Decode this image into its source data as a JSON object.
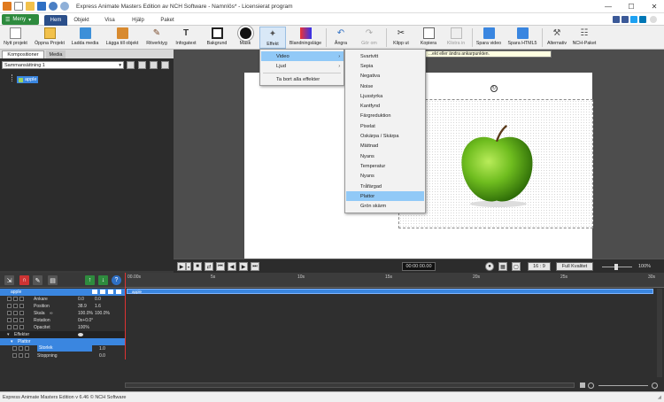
{
  "window": {
    "title": "Express Animate Masters Edition av NCH Software - Namnlös* - Licensierat program"
  },
  "menubar": {
    "menu_button": "Meny",
    "tabs": [
      "Hem",
      "Objekt",
      "Visa",
      "Hjälp",
      "Paket"
    ],
    "active_tab": "Hem"
  },
  "toolbar": {
    "buttons": [
      {
        "label": "Nytt projekt",
        "icon": "new-project-icon"
      },
      {
        "label": "Öppna Projekt",
        "icon": "open-project-icon"
      },
      {
        "label": "Ladda media",
        "icon": "load-media-icon"
      },
      {
        "label": "Lägga till objekt",
        "icon": "add-object-icon"
      },
      {
        "label": "Ritverktyg",
        "icon": "draw-tool-icon"
      },
      {
        "label": "Infogatext",
        "icon": "text-icon"
      },
      {
        "label": "Bakgrund",
        "icon": "background-icon"
      },
      {
        "label": "Mask",
        "icon": "mask-icon"
      },
      {
        "label": "Effekt",
        "icon": "effect-icon"
      },
      {
        "label": "Blandningsläge",
        "icon": "blend-mode-icon"
      },
      {
        "label": "Ångra",
        "icon": "undo-icon"
      },
      {
        "label": "Gör om",
        "icon": "redo-icon"
      },
      {
        "label": "Klipp ut",
        "icon": "cut-icon"
      },
      {
        "label": "Kopiera",
        "icon": "copy-icon"
      },
      {
        "label": "Klistra in",
        "icon": "paste-icon"
      },
      {
        "label": "Spara video",
        "icon": "save-video-icon"
      },
      {
        "label": "Spara HTML5",
        "icon": "save-html5-icon"
      },
      {
        "label": "Alternativ",
        "icon": "options-icon"
      },
      {
        "label": "NCH-Paket",
        "icon": "nch-suite-icon"
      }
    ]
  },
  "left_panel": {
    "tabs": [
      "Kompositioner",
      "Media"
    ],
    "composition_select": "Sammansättning 1",
    "tree_item": "apple"
  },
  "canvas": {
    "tooltip": "...ekt eller ändra ankarpunkten."
  },
  "context_menu": {
    "items": [
      "Video",
      "Ljud",
      "Ta bort alla effekter"
    ],
    "submenu": [
      "Svartvitt",
      "Sepia",
      "Negativa",
      "Noise",
      "Ljusstyrka",
      "Kantfynd",
      "Färgreduktion",
      "Pixelat",
      "Oskärpa / Skärpa",
      "Mättnad",
      "Nyans",
      "Temperatur",
      "Nyans",
      "Tråfärgad",
      "Plattor",
      "Grön skärm"
    ],
    "highlighted": "Plattor"
  },
  "playback": {
    "timecode": "00:00:00.00",
    "aspect": "16 : 9",
    "quality": "Full Kvalitet",
    "zoom": "100%"
  },
  "timeline": {
    "ruler": [
      "00.00s",
      "5s",
      "10s",
      "15s",
      "20s",
      "25s",
      "30s"
    ],
    "track_name": "apple",
    "rows": [
      {
        "name": "apple",
        "v1": "",
        "v2": ""
      },
      {
        "name": "Ankare",
        "v1": "0.0",
        "v2": "0.0"
      },
      {
        "name": "Position",
        "v1": "38.9",
        "v2": "1.6"
      },
      {
        "name": "Skala",
        "v1": "100.0%",
        "v2": "100.0%"
      },
      {
        "name": "Rotation",
        "v1": "0x+0.0°",
        "v2": ""
      },
      {
        "name": "Opacitet",
        "v1": "100%",
        "v2": ""
      },
      {
        "name": "Effekter",
        "v1": "",
        "v2": ""
      },
      {
        "name": "Plattor",
        "v1": "",
        "v2": ""
      },
      {
        "name": "Storlek",
        "v1": "1.0",
        "v2": ""
      },
      {
        "name": "Stoppning",
        "v1": "0.0",
        "v2": ""
      }
    ]
  },
  "statusbar": {
    "text": "Express Animate Masters Edition v 6.46 © NCH Software"
  }
}
